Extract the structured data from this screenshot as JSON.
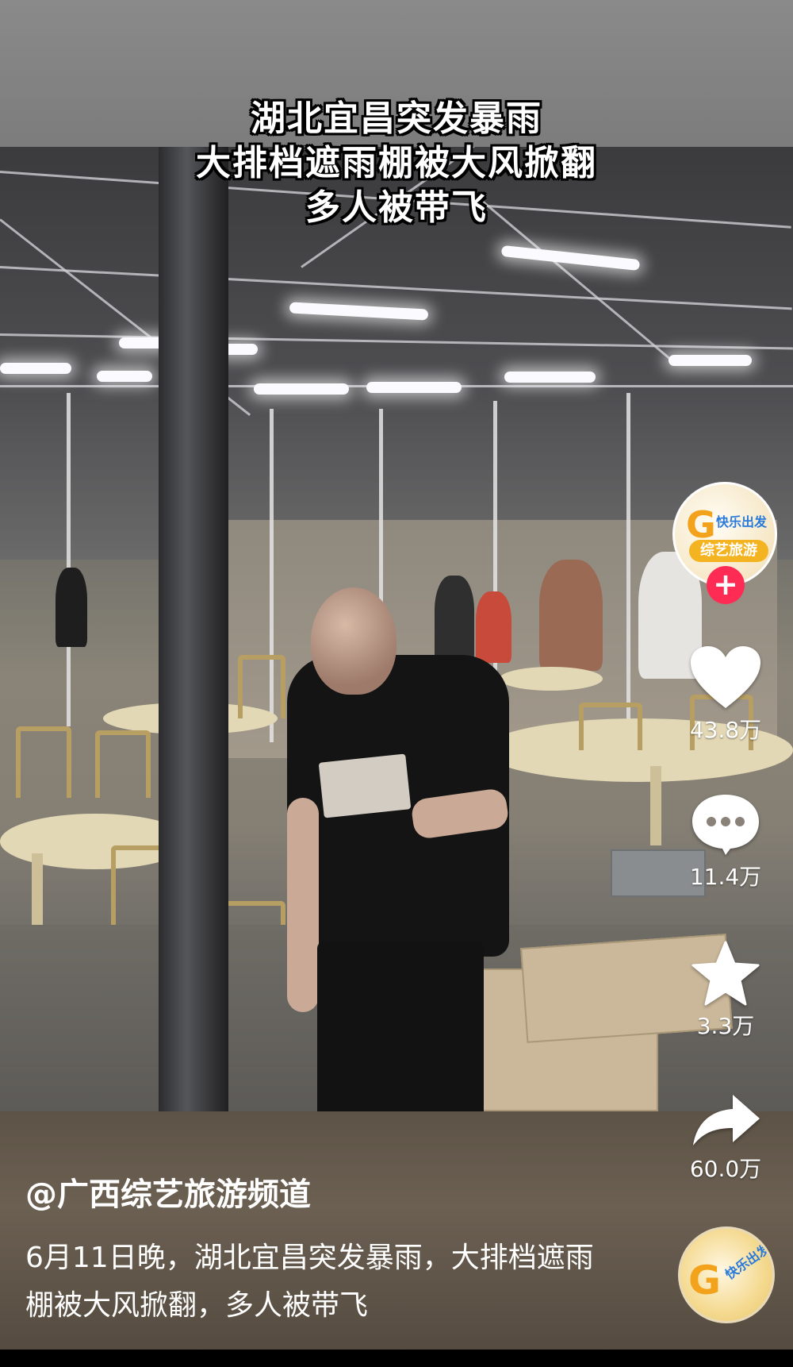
{
  "video": {
    "headline_lines": [
      "湖北宜昌突发暴雨",
      "大排档遮雨棚被大风掀翻",
      "多人被带飞"
    ]
  },
  "account": {
    "avatar_logo_letter": "G",
    "avatar_text_top": "快乐出发",
    "avatar_text_bottom": "综艺旅游",
    "follow_symbol": "+"
  },
  "actions": {
    "likes": "43.8万",
    "comments": "11.4万",
    "favorites": "3.3万",
    "shares": "60.0万"
  },
  "icons": {
    "like": "heart-icon",
    "comment": "comment-bubble-icon",
    "favorite": "star-icon",
    "share": "share-arrow-icon"
  },
  "post": {
    "author": "@广西综艺旅游频道",
    "description": "6月11日晚，湖北宜昌突发暴雨，大排档遮雨棚被大风掀翻，多人被带飞"
  },
  "music": {
    "disc_logo_letter": "G",
    "disc_text": "快乐出发"
  },
  "colors": {
    "follow_red": "#fe2c55",
    "brand_orange": "#f2a21b",
    "brand_blue": "#2a7ad9"
  }
}
